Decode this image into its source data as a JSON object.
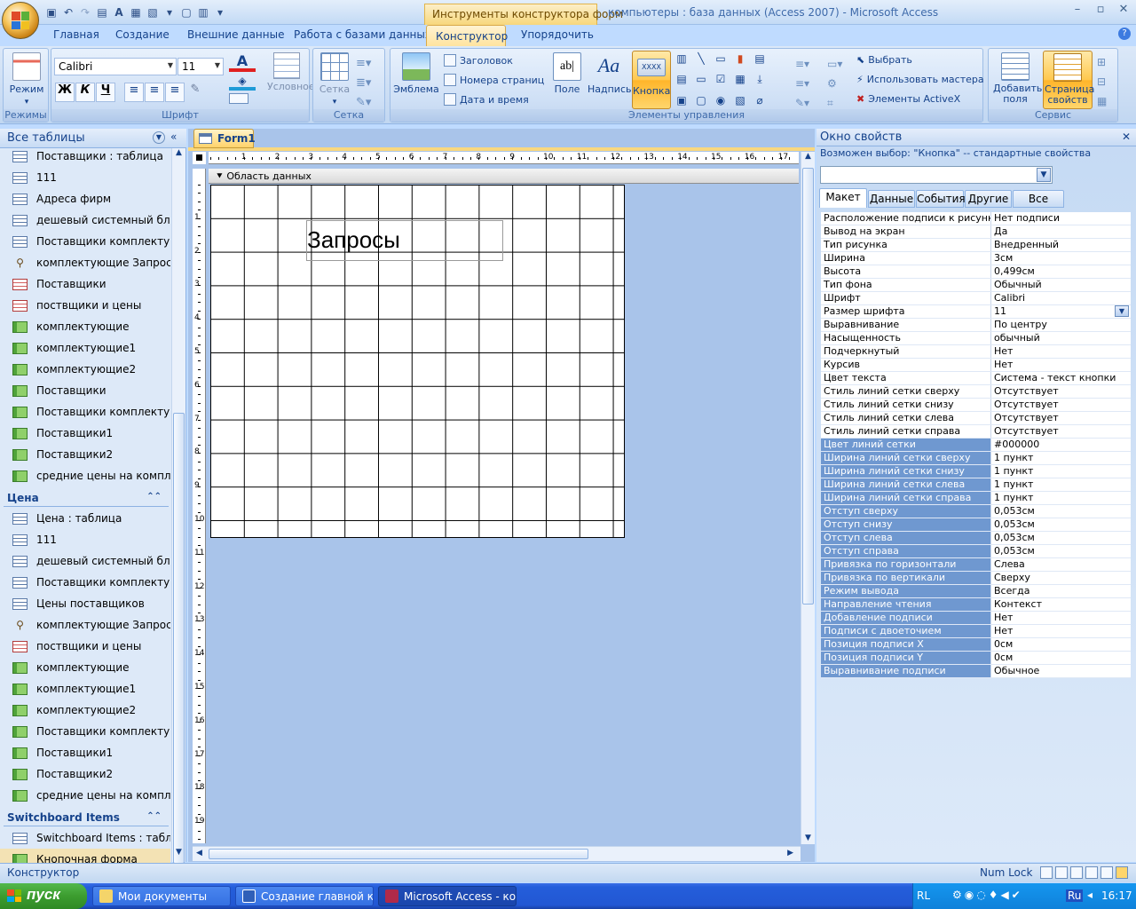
{
  "window": {
    "context_tools": "Инструменты конструктора форм",
    "title": "компьютеры : база данных (Access 2007) - Microsoft Access"
  },
  "tabs": [
    "Главная",
    "Создание",
    "Внешние данные",
    "Работа с базами данных",
    "Конструктор",
    "Упорядочить"
  ],
  "ribbon": {
    "modes": {
      "button": "Режим",
      "group": "Режимы"
    },
    "font": {
      "family": "Calibri",
      "size": "11",
      "conditional": "Условное",
      "group": "Шрифт",
      "bold": "Ж",
      "italic": "К",
      "underline": "Ч"
    },
    "grid": {
      "button": "Сетка",
      "group": "Сетка"
    },
    "controls": {
      "logo": "Эмблема",
      "title": "Заголовок",
      "page_numbers": "Номера страниц",
      "date_time": "Дата и время",
      "field": "Поле",
      "label": "Надпись",
      "button": "Кнопка",
      "select": "Выбрать",
      "use_wizard": "Использовать мастера",
      "activex": "Элементы ActiveX",
      "group": "Элементы управления",
      "field_icon_text": "ab|",
      "label_icon_text": "Aa",
      "button_icon_text": "XXXX"
    },
    "tools": {
      "add_fields": "Добавить поля",
      "property_sheet": "Страница свойств",
      "group": "Сервис"
    }
  },
  "nav": {
    "header": "Все таблицы",
    "groups": [
      {
        "name": "",
        "items": [
          {
            "label": "Поставщики : таблица",
            "type": "table"
          },
          {
            "label": "111",
            "type": "form"
          },
          {
            "label": "Адреса фирм",
            "type": "form"
          },
          {
            "label": "дешевый системный блок",
            "type": "form"
          },
          {
            "label": "Поставщики комплекту...",
            "type": "form"
          },
          {
            "label": "комплектующие Запрос",
            "type": "query"
          },
          {
            "label": "Поставщики",
            "type": "report"
          },
          {
            "label": "поствщики и цены",
            "type": "report"
          },
          {
            "label": "комплектующие",
            "type": "macro"
          },
          {
            "label": "комплектующие1",
            "type": "macro"
          },
          {
            "label": "комплектующие2",
            "type": "macro"
          },
          {
            "label": "Поставщики",
            "type": "macro"
          },
          {
            "label": "Поставщики комплекту...",
            "type": "macro"
          },
          {
            "label": "Поставщики1",
            "type": "macro"
          },
          {
            "label": "Поставщики2",
            "type": "macro"
          },
          {
            "label": "средние цены на компл...",
            "type": "macro"
          }
        ]
      },
      {
        "name": "Цена",
        "items": [
          {
            "label": "Цена : таблица",
            "type": "table"
          },
          {
            "label": "111",
            "type": "form"
          },
          {
            "label": "дешевый системный блок",
            "type": "form"
          },
          {
            "label": "Поставщики комплекту...",
            "type": "form"
          },
          {
            "label": "Цены поставщиков",
            "type": "form"
          },
          {
            "label": "комплектующие Запрос",
            "type": "query"
          },
          {
            "label": "поствщики и цены",
            "type": "report"
          },
          {
            "label": "комплектующие",
            "type": "macro"
          },
          {
            "label": "комплектующие1",
            "type": "macro"
          },
          {
            "label": "комплектующие2",
            "type": "macro"
          },
          {
            "label": "Поставщики комплекту...",
            "type": "macro"
          },
          {
            "label": "Поставщики1",
            "type": "macro"
          },
          {
            "label": "Поставщики2",
            "type": "macro"
          },
          {
            "label": "средние цены на компл...",
            "type": "macro"
          }
        ]
      },
      {
        "name": "Switchboard Items",
        "items": [
          {
            "label": "Switchboard Items : табл...",
            "type": "table"
          },
          {
            "label": "Кнопочная форма",
            "type": "macro"
          }
        ]
      }
    ]
  },
  "document": {
    "tab": "Form1",
    "section": "Область данных",
    "button_caption": "Запросы",
    "ruler_h": [
      "1",
      "2",
      "3",
      "4",
      "5",
      "6",
      "7",
      "8",
      "9",
      "10",
      "11",
      "12",
      "13",
      "14",
      "15",
      "16",
      "17"
    ],
    "ruler_v": [
      "1",
      "2",
      "3",
      "4",
      "5",
      "6",
      "7",
      "8",
      "9",
      "10",
      "11",
      "12",
      "13",
      "14",
      "15",
      "16",
      "17",
      "18",
      "19"
    ]
  },
  "properties": {
    "header": "Окно свойств",
    "selection": "Возможен выбор:  \"Кнопка\" -- стандартные свойства",
    "tabs": [
      "Макет",
      "Данные",
      "События",
      "Другие",
      "Все"
    ],
    "active_tab": "Макет",
    "rows": [
      [
        "Расположение подписи к рисунку",
        "Нет подписи"
      ],
      [
        "Вывод на экран",
        "Да"
      ],
      [
        "Тип рисунка",
        "Внедренный"
      ],
      [
        "Ширина",
        "3см"
      ],
      [
        "Высота",
        "0,499см"
      ],
      [
        "Тип фона",
        "Обычный"
      ],
      [
        "Шрифт",
        "Calibri"
      ],
      [
        "Размер шрифта",
        "11"
      ],
      [
        "Выравнивание",
        "По центру"
      ],
      [
        "Насыщенность",
        "обычный"
      ],
      [
        "Подчеркнутый",
        "Нет"
      ],
      [
        "Курсив",
        "Нет"
      ],
      [
        "Цвет текста",
        "Система - текст кнопки"
      ],
      [
        "Стиль линий сетки сверху",
        "Отсутствует"
      ],
      [
        "Стиль линий сетки снизу",
        "Отсутствует"
      ],
      [
        "Стиль линий сетки слева",
        "Отсутствует"
      ],
      [
        "Стиль линий сетки справа",
        "Отсутствует"
      ],
      [
        "Цвет линий сетки",
        "#000000"
      ],
      [
        "Ширина линий сетки сверху",
        "1 пункт"
      ],
      [
        "Ширина линий сетки снизу",
        "1 пункт"
      ],
      [
        "Ширина линий сетки слева",
        "1 пункт"
      ],
      [
        "Ширина линий сетки справа",
        "1 пункт"
      ],
      [
        "Отступ сверху",
        "0,053см"
      ],
      [
        "Отступ снизу",
        "0,053см"
      ],
      [
        "Отступ слева",
        "0,053см"
      ],
      [
        "Отступ справа",
        "0,053см"
      ],
      [
        "Привязка по горизонтали",
        "Слева"
      ],
      [
        "Привязка по вертикали",
        "Сверху"
      ],
      [
        "Режим вывода",
        "Всегда"
      ],
      [
        "Направление чтения",
        "Контекст"
      ],
      [
        "Добавление подписи",
        "Нет"
      ],
      [
        "Подписи с двоеточием",
        "Нет"
      ],
      [
        "Позиция подписи X",
        "0см"
      ],
      [
        "Позиция подписи Y",
        "0см"
      ],
      [
        "Выравнивание подписи",
        "Обычное"
      ]
    ]
  },
  "status": {
    "left": "Конструктор",
    "numlock": "Num Lock"
  },
  "taskbar": {
    "start": "пуск",
    "buttons": [
      "Мои документы",
      "Создание главной кн...",
      "Microsoft Access - ком..."
    ],
    "lang": "RL",
    "lang2": "Ru",
    "clock": "16:17"
  },
  "colors": {
    "accent": "#15428b",
    "ribbon_highlight": "#ffc84e",
    "taskbar": "#245edb"
  }
}
